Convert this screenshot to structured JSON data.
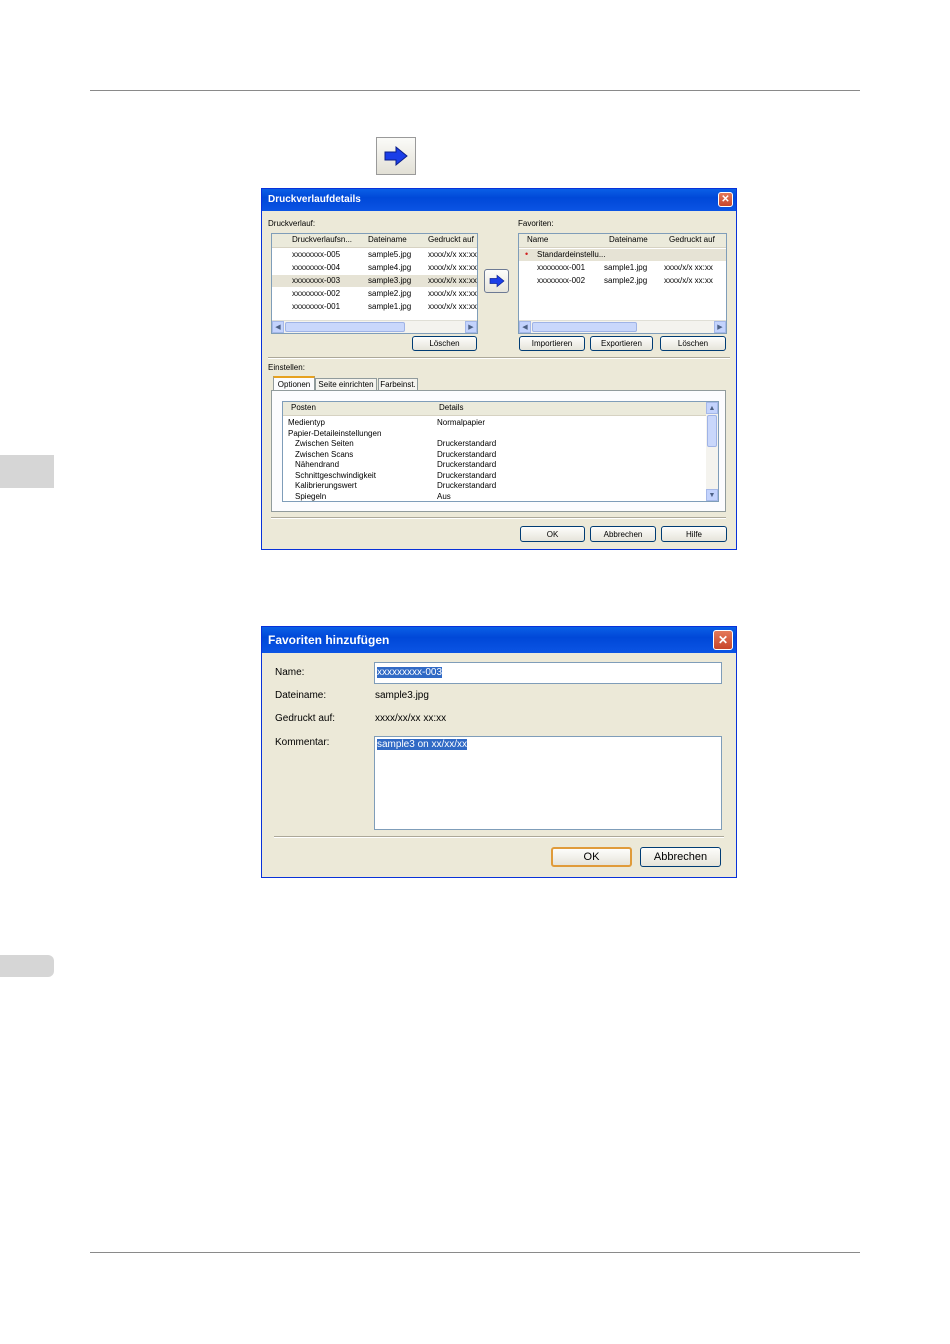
{
  "dialog1": {
    "title": "Druckverlaufdetails",
    "history_label": "Druckverlauf:",
    "history_columns": [
      "Druckverlaufsn...",
      "Dateiname",
      "Gedruckt auf"
    ],
    "history_rows": [
      {
        "name": "xxxxxxxx-005",
        "file": "sample5.jpg",
        "date": "xxxx/x/x xx:xx"
      },
      {
        "name": "xxxxxxxx-004",
        "file": "sample4.jpg",
        "date": "xxxx/x/x xx:xx"
      },
      {
        "name": "xxxxxxxx-003",
        "file": "sample3.jpg",
        "date": "xxxx/x/x xx:xx"
      },
      {
        "name": "xxxxxxxx-002",
        "file": "sample2.jpg",
        "date": "xxxx/x/x xx:xx"
      },
      {
        "name": "xxxxxxxx-001",
        "file": "sample1.jpg",
        "date": "xxxx/x/x xx:xx"
      }
    ],
    "history_delete": "Löschen",
    "favorites_label": "Favoriten:",
    "favorites_columns": [
      "Name",
      "Dateiname",
      "Gedruckt auf"
    ],
    "favorites_rows": [
      {
        "name": "Standardeinstellu...",
        "file": "",
        "date": ""
      },
      {
        "name": "xxxxxxxx-001",
        "file": "sample1.jpg",
        "date": "xxxx/x/x xx:xx"
      },
      {
        "name": "xxxxxxxx-002",
        "file": "sample2.jpg",
        "date": "xxxx/x/x xx:xx"
      }
    ],
    "import": "Importieren",
    "export": "Exportieren",
    "favorites_delete": "Löschen",
    "settings_label": "Einstellen:",
    "tabs": [
      "Optionen",
      "Seite einrichten",
      "Farbeinst."
    ],
    "settings_columns": [
      "Posten",
      "Details"
    ],
    "settings_rows": [
      {
        "item": "Medientyp",
        "detail": "Normalpapier",
        "indent": false
      },
      {
        "item": "Papier-Detaileinstellungen",
        "detail": "",
        "indent": false
      },
      {
        "item": "Zwischen Seiten",
        "detail": "Druckerstandard",
        "indent": true
      },
      {
        "item": "Zwischen Scans",
        "detail": "Druckerstandard",
        "indent": true
      },
      {
        "item": "Nähendrand",
        "detail": "Druckerstandard",
        "indent": true
      },
      {
        "item": "Schnittgeschwindigkeit",
        "detail": "Druckerstandard",
        "indent": true
      },
      {
        "item": "Kalibrierungswert",
        "detail": "Druckerstandard",
        "indent": true
      },
      {
        "item": "Spiegeln",
        "detail": "Aus",
        "indent": true
      }
    ],
    "ok": "OK",
    "cancel": "Abbrechen",
    "help": "Hilfe"
  },
  "dialog2": {
    "title": "Favoriten hinzufügen",
    "name_label": "Name:",
    "name_value": "xxxxxxxxx-003",
    "file_label": "Dateiname:",
    "file_value": "sample3.jpg",
    "printed_label": "Gedruckt auf:",
    "printed_value": "xxxx/xx/xx xx:xx",
    "comment_label": "Kommentar:",
    "comment_value": "sample3 on xx/xx/xx",
    "ok": "OK",
    "cancel": "Abbrechen"
  },
  "colors": {
    "titlebar": "#0054e3",
    "dialog_bg": "#ece9d8",
    "selection": "#316ac5"
  }
}
